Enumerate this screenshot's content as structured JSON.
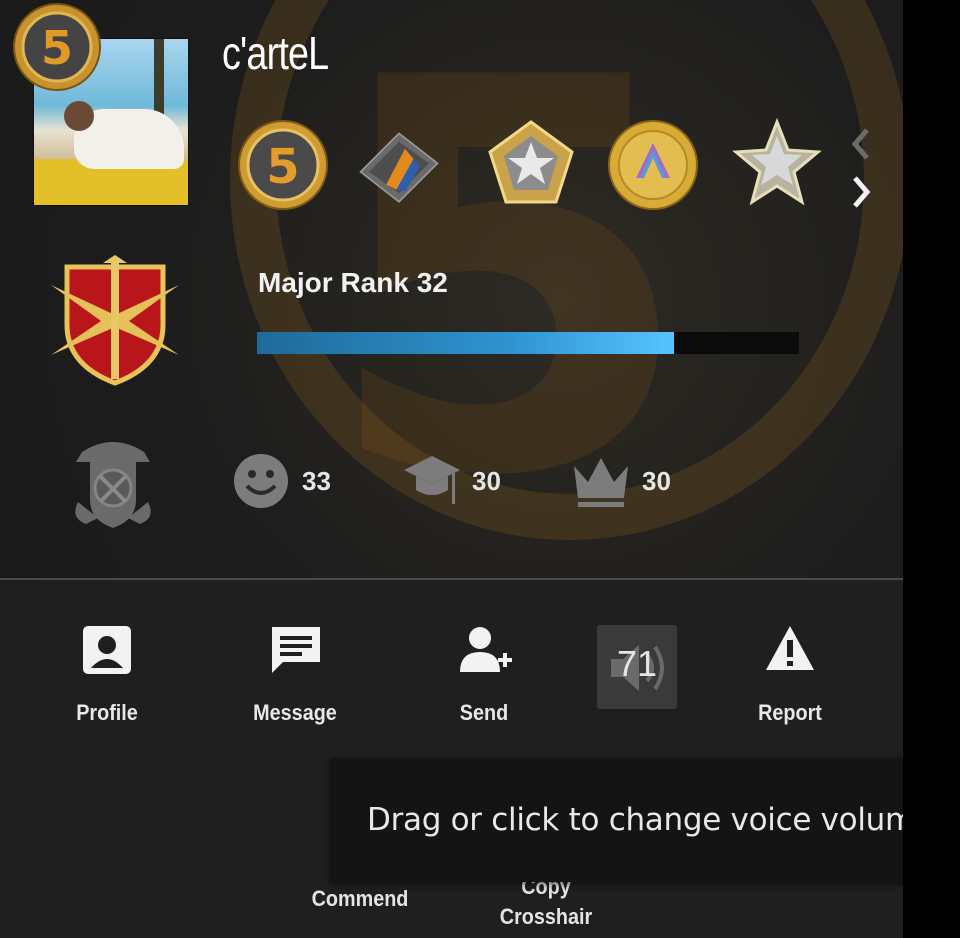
{
  "player": {
    "name": "c'arteL",
    "rank_coin_label": "5"
  },
  "medals": [
    {
      "name": "five-year-veteran-coin",
      "label": "5"
    },
    {
      "name": "operation-coin"
    },
    {
      "name": "pentagon-star-medal"
    },
    {
      "name": "gold-service-coin"
    },
    {
      "name": "star-medal"
    }
  ],
  "rank": {
    "label": "Major Rank 32",
    "progress": 0.77
  },
  "stats": {
    "friendly": "33",
    "teacher": "30",
    "leader": "30"
  },
  "actions": {
    "profile": "Profile",
    "message": "Message",
    "send": "Send",
    "volume": "71",
    "report": "Report",
    "commend": "Commend",
    "copy_crosshair": "Copy\nCrosshair"
  },
  "tooltip": {
    "text": "Drag or click to change voice volume"
  },
  "colors": {
    "xp_fill": "#56c4ff",
    "medal_gold": "#d9a63a"
  }
}
